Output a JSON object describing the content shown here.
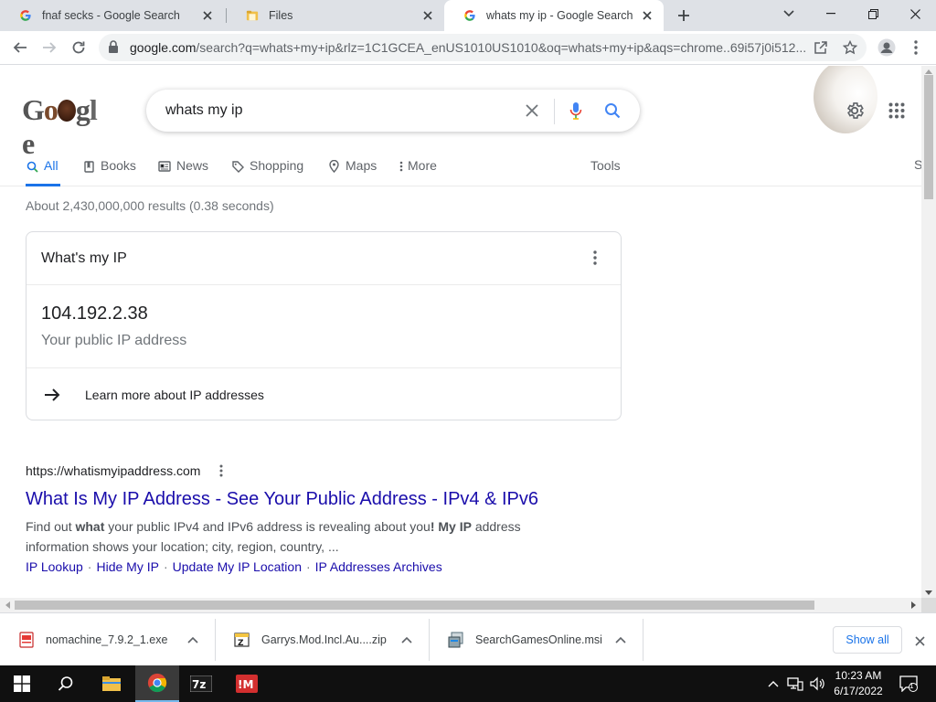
{
  "browser": {
    "tabs": [
      {
        "title": "fnaf secks - Google Search",
        "active": false
      },
      {
        "title": "Files",
        "active": false
      },
      {
        "title": "whats my ip - Google Search",
        "active": true
      }
    ],
    "url_host": "google.com",
    "url_rest": "/search?q=whats+my+ip&rlz=1C1GCEA_enUS1010US1010&oq=whats+my+ip&aqs=chrome..69i57j0i512..."
  },
  "google": {
    "logo": "Google",
    "query": "whats my ip",
    "nav_tabs": [
      "All",
      "Books",
      "News",
      "Shopping",
      "Maps",
      "More"
    ],
    "tools_label": "Tools",
    "cut_label": "S",
    "stats": "About 2,430,000,000 results (0.38 seconds)"
  },
  "ip_card": {
    "title": "What's my IP",
    "ip": "104.192.2.38",
    "label": "Your public IP address",
    "learn_more": "Learn more about IP addresses"
  },
  "result": {
    "url": "https://whatismyipaddress.com",
    "title": "What Is My IP Address - See Your Public Address - IPv4 & IPv6",
    "snippet_parts": [
      {
        "t": "Find out ",
        "b": false
      },
      {
        "t": "what",
        "b": true
      },
      {
        "t": " your public IPv4 and IPv6 address is revealing about you",
        "b": false
      },
      {
        "t": "! My IP",
        "b": true
      },
      {
        "t": " address information shows your location; city, region, country, ...",
        "b": false
      }
    ],
    "sitelinks": [
      "IP Lookup",
      "Hide My IP",
      "Update My IP Location",
      "IP Addresses Archives"
    ]
  },
  "downloads": {
    "items": [
      "nomachine_7.9.2_1.exe",
      "Garrys.Mod.Incl.Au....zip",
      "SearchGamesOnline.msi"
    ],
    "show_all": "Show all"
  },
  "taskbar": {
    "time": "10:23 AM",
    "date": "6/17/2022",
    "notification_count": "1",
    "apps": [
      "start-button",
      "search",
      "file-explorer",
      "chrome",
      "7-zip",
      "iobit"
    ]
  },
  "colors": {
    "link": "#1a0dab",
    "accent": "#1a73e8",
    "tabstrip": "#dee1e6",
    "taskbar": "#101010"
  }
}
